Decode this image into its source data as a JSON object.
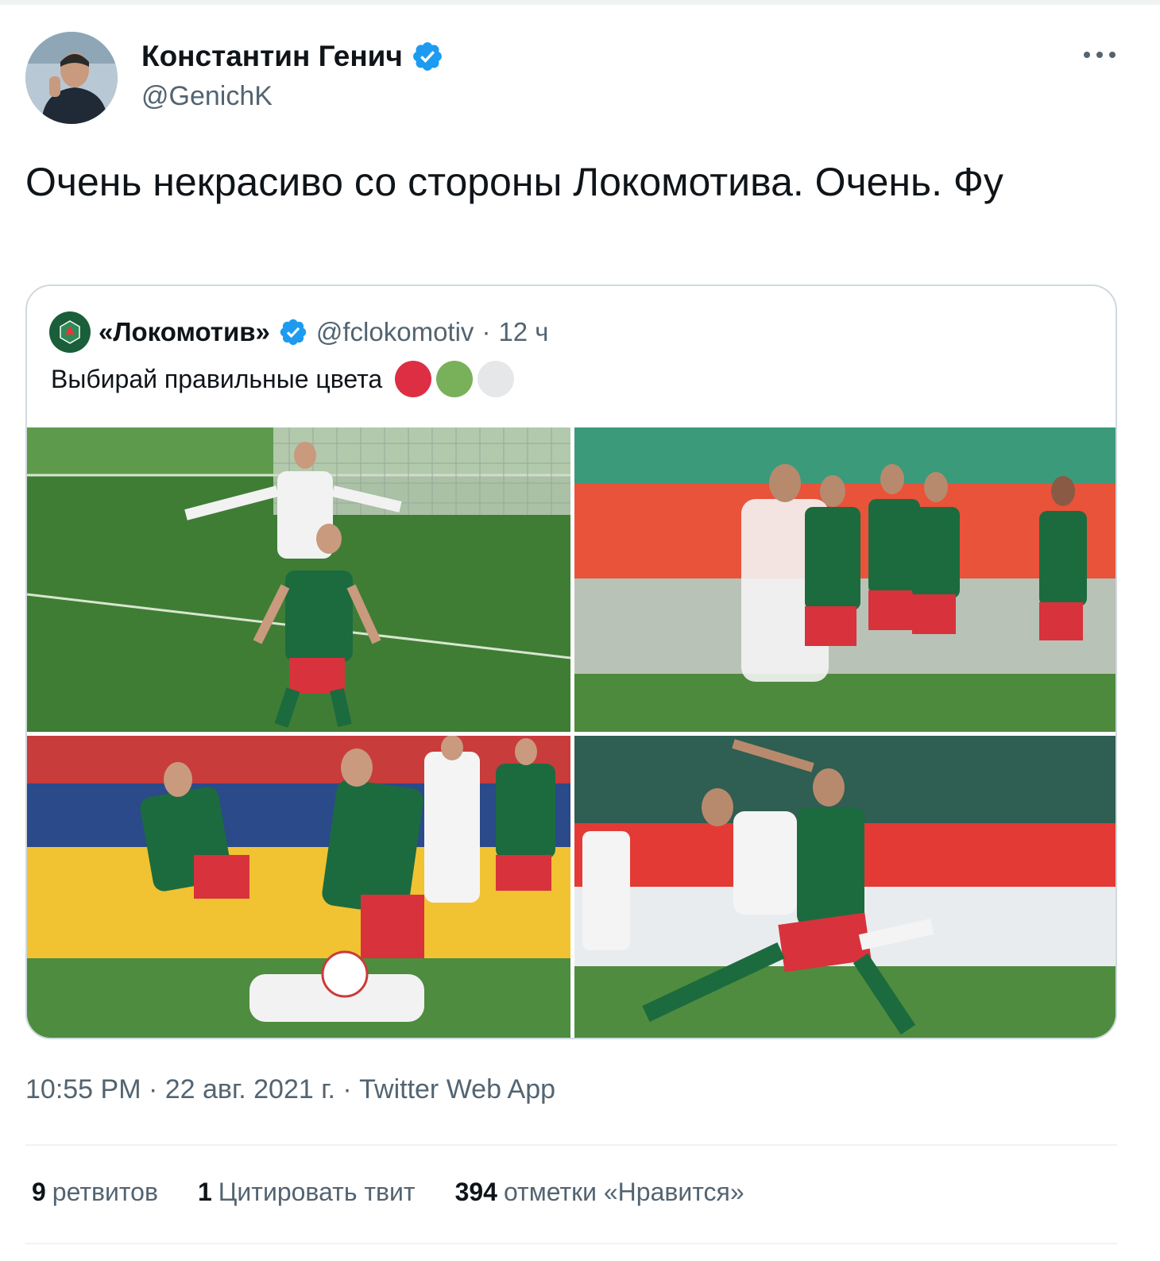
{
  "author": {
    "name": "Константин Генич",
    "handle": "@GenichK"
  },
  "tweet": {
    "text": "Очень некрасиво со стороны Локомотива. Очень. Фу"
  },
  "quoted": {
    "name": "«Локомотив»",
    "handle": "@fclokomotiv",
    "separator": "·",
    "time": "12 ч",
    "text": "Выбирай правильные цвета",
    "emoji_colors": [
      "#dd2e44",
      "#78b159",
      "#e6e7e8"
    ],
    "photos": [
      "goal-celebration-photo",
      "team-huddle-photo",
      "ball-tackle-photo",
      "challenge-photo"
    ]
  },
  "meta": {
    "text": "10:55 PM · 22 авг. 2021 г. · Twitter Web App"
  },
  "stats": {
    "retweets_count": "9",
    "retweets_label": "ретвитов",
    "quotes_count": "1",
    "quotes_label": "Цитировать твит",
    "likes_count": "394",
    "likes_label": "отметки «Нравится»"
  },
  "colors": {
    "verified": "#1d9bf0",
    "secondary_text": "#536471",
    "primary_text": "#0f1419",
    "border": "#cfd9de"
  }
}
